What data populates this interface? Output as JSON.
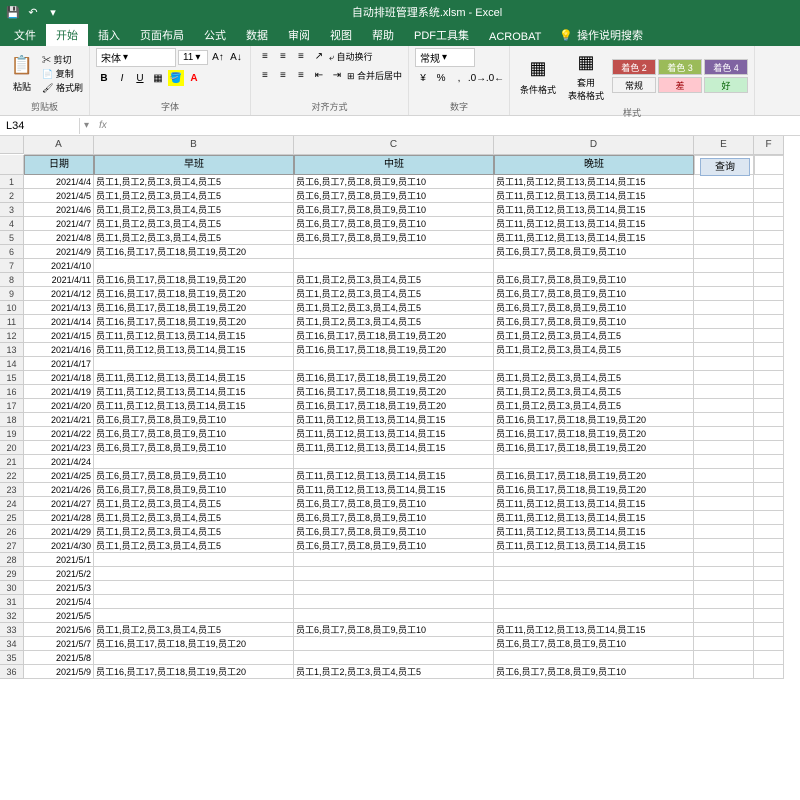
{
  "app": {
    "title": "自动排班管理系统.xlsm - Excel"
  },
  "qat": {
    "save": "💾",
    "undo": "↶"
  },
  "tabs": {
    "file": "文件",
    "home": "开始",
    "insert": "插入",
    "layout": "页面布局",
    "formulas": "公式",
    "data": "数据",
    "review": "审阅",
    "view": "视图",
    "help": "帮助",
    "pdf": "PDF工具集",
    "acrobat": "ACROBAT",
    "tellme": "操作说明搜索"
  },
  "ribbon": {
    "clipboard": {
      "label": "剪贴板",
      "paste": "粘贴",
      "cut": "剪切",
      "copy": "复制",
      "painter": "格式刷"
    },
    "font": {
      "label": "字体",
      "name": "宋体",
      "size": "11"
    },
    "align": {
      "label": "对齐方式",
      "wrap": "自动换行",
      "merge": "合并后居中"
    },
    "number": {
      "label": "数字",
      "format": "常规"
    },
    "styles": {
      "label": "样式",
      "condfmt": "条件格式",
      "tablefmt": "套用\n表格格式",
      "s1": "着色 2",
      "s2": "着色 3",
      "s3": "着色 4",
      "s4": "常规",
      "s5": "差",
      "s6": "好"
    }
  },
  "namebox": {
    "ref": "L34",
    "fx": "fx"
  },
  "colHeaders": [
    "A",
    "B",
    "C",
    "D",
    "E",
    "F"
  ],
  "tableHeaders": {
    "date": "日期",
    "morning": "早班",
    "mid": "中班",
    "night": "晚班"
  },
  "queryBtn": "查询",
  "rows": [
    {
      "n": 1,
      "date": "2021/4/4",
      "b": "员工1,员工2,员工3,员工4,员工5",
      "c": "员工6,员工7,员工8,员工9,员工10",
      "d": "员工11,员工12,员工13,员工14,员工15"
    },
    {
      "n": 2,
      "date": "2021/4/5",
      "b": "员工1,员工2,员工3,员工4,员工5",
      "c": "员工6,员工7,员工8,员工9,员工10",
      "d": "员工11,员工12,员工13,员工14,员工15"
    },
    {
      "n": 3,
      "date": "2021/4/6",
      "b": "员工1,员工2,员工3,员工4,员工5",
      "c": "员工6,员工7,员工8,员工9,员工10",
      "d": "员工11,员工12,员工13,员工14,员工15"
    },
    {
      "n": 4,
      "date": "2021/4/7",
      "b": "员工1,员工2,员工3,员工4,员工5",
      "c": "员工6,员工7,员工8,员工9,员工10",
      "d": "员工11,员工12,员工13,员工14,员工15"
    },
    {
      "n": 5,
      "date": "2021/4/8",
      "b": "员工1,员工2,员工3,员工4,员工5",
      "c": "员工6,员工7,员工8,员工9,员工10",
      "d": "员工11,员工12,员工13,员工14,员工15"
    },
    {
      "n": 6,
      "date": "2021/4/9",
      "b": "员工16,员工17,员工18,员工19,员工20",
      "c": "",
      "d": "员工6,员工7,员工8,员工9,员工10"
    },
    {
      "n": 7,
      "date": "2021/4/10",
      "b": "",
      "c": "",
      "d": ""
    },
    {
      "n": 8,
      "date": "2021/4/11",
      "b": "员工16,员工17,员工18,员工19,员工20",
      "c": "员工1,员工2,员工3,员工4,员工5",
      "d": "员工6,员工7,员工8,员工9,员工10"
    },
    {
      "n": 9,
      "date": "2021/4/12",
      "b": "员工16,员工17,员工18,员工19,员工20",
      "c": "员工1,员工2,员工3,员工4,员工5",
      "d": "员工6,员工7,员工8,员工9,员工10"
    },
    {
      "n": 10,
      "date": "2021/4/13",
      "b": "员工16,员工17,员工18,员工19,员工20",
      "c": "员工1,员工2,员工3,员工4,员工5",
      "d": "员工6,员工7,员工8,员工9,员工10"
    },
    {
      "n": 11,
      "date": "2021/4/14",
      "b": "员工16,员工17,员工18,员工19,员工20",
      "c": "员工1,员工2,员工3,员工4,员工5",
      "d": "员工6,员工7,员工8,员工9,员工10"
    },
    {
      "n": 12,
      "date": "2021/4/15",
      "b": "员工11,员工12,员工13,员工14,员工15",
      "c": "员工16,员工17,员工18,员工19,员工20",
      "d": "员工1,员工2,员工3,员工4,员工5"
    },
    {
      "n": 13,
      "date": "2021/4/16",
      "b": "员工11,员工12,员工13,员工14,员工15",
      "c": "员工16,员工17,员工18,员工19,员工20",
      "d": "员工1,员工2,员工3,员工4,员工5"
    },
    {
      "n": 14,
      "date": "2021/4/17",
      "b": "",
      "c": "",
      "d": ""
    },
    {
      "n": 15,
      "date": "2021/4/18",
      "b": "员工11,员工12,员工13,员工14,员工15",
      "c": "员工16,员工17,员工18,员工19,员工20",
      "d": "员工1,员工2,员工3,员工4,员工5"
    },
    {
      "n": 16,
      "date": "2021/4/19",
      "b": "员工11,员工12,员工13,员工14,员工15",
      "c": "员工16,员工17,员工18,员工19,员工20",
      "d": "员工1,员工2,员工3,员工4,员工5"
    },
    {
      "n": 17,
      "date": "2021/4/20",
      "b": "员工11,员工12,员工13,员工14,员工15",
      "c": "员工16,员工17,员工18,员工19,员工20",
      "d": "员工1,员工2,员工3,员工4,员工5"
    },
    {
      "n": 18,
      "date": "2021/4/21",
      "b": "员工6,员工7,员工8,员工9,员工10",
      "c": "员工11,员工12,员工13,员工14,员工15",
      "d": "员工16,员工17,员工18,员工19,员工20"
    },
    {
      "n": 19,
      "date": "2021/4/22",
      "b": "员工6,员工7,员工8,员工9,员工10",
      "c": "员工11,员工12,员工13,员工14,员工15",
      "d": "员工16,员工17,员工18,员工19,员工20"
    },
    {
      "n": 20,
      "date": "2021/4/23",
      "b": "员工6,员工7,员工8,员工9,员工10",
      "c": "员工11,员工12,员工13,员工14,员工15",
      "d": "员工16,员工17,员工18,员工19,员工20"
    },
    {
      "n": 21,
      "date": "2021/4/24",
      "b": "",
      "c": "",
      "d": ""
    },
    {
      "n": 22,
      "date": "2021/4/25",
      "b": "员工6,员工7,员工8,员工9,员工10",
      "c": "员工11,员工12,员工13,员工14,员工15",
      "d": "员工16,员工17,员工18,员工19,员工20"
    },
    {
      "n": 23,
      "date": "2021/4/26",
      "b": "员工6,员工7,员工8,员工9,员工10",
      "c": "员工11,员工12,员工13,员工14,员工15",
      "d": "员工16,员工17,员工18,员工19,员工20"
    },
    {
      "n": 24,
      "date": "2021/4/27",
      "b": "员工1,员工2,员工3,员工4,员工5",
      "c": "员工6,员工7,员工8,员工9,员工10",
      "d": "员工11,员工12,员工13,员工14,员工15"
    },
    {
      "n": 25,
      "date": "2021/4/28",
      "b": "员工1,员工2,员工3,员工4,员工5",
      "c": "员工6,员工7,员工8,员工9,员工10",
      "d": "员工11,员工12,员工13,员工14,员工15"
    },
    {
      "n": 26,
      "date": "2021/4/29",
      "b": "员工1,员工2,员工3,员工4,员工5",
      "c": "员工6,员工7,员工8,员工9,员工10",
      "d": "员工11,员工12,员工13,员工14,员工15"
    },
    {
      "n": 27,
      "date": "2021/4/30",
      "b": "员工1,员工2,员工3,员工4,员工5",
      "c": "员工6,员工7,员工8,员工9,员工10",
      "d": "员工11,员工12,员工13,员工14,员工15"
    },
    {
      "n": 28,
      "date": "2021/5/1",
      "b": "",
      "c": "",
      "d": ""
    },
    {
      "n": 29,
      "date": "2021/5/2",
      "b": "",
      "c": "",
      "d": ""
    },
    {
      "n": 30,
      "date": "2021/5/3",
      "b": "",
      "c": "",
      "d": ""
    },
    {
      "n": 31,
      "date": "2021/5/4",
      "b": "",
      "c": "",
      "d": ""
    },
    {
      "n": 32,
      "date": "2021/5/5",
      "b": "",
      "c": "",
      "d": ""
    },
    {
      "n": 33,
      "date": "2021/5/6",
      "b": "员工1,员工2,员工3,员工4,员工5",
      "c": "员工6,员工7,员工8,员工9,员工10",
      "d": "员工11,员工12,员工13,员工14,员工15"
    },
    {
      "n": 34,
      "date": "2021/5/7",
      "b": "员工16,员工17,员工18,员工19,员工20",
      "c": "",
      "d": "员工6,员工7,员工8,员工9,员工10"
    },
    {
      "n": 35,
      "date": "2021/5/8",
      "b": "",
      "c": "",
      "d": ""
    },
    {
      "n": 36,
      "date": "2021/5/9",
      "b": "员工16,员工17,员工18,员工19,员工20",
      "c": "员工1,员工2,员工3,员工4,员工5",
      "d": "员工6,员工7,员工8,员工9,员工10"
    }
  ]
}
